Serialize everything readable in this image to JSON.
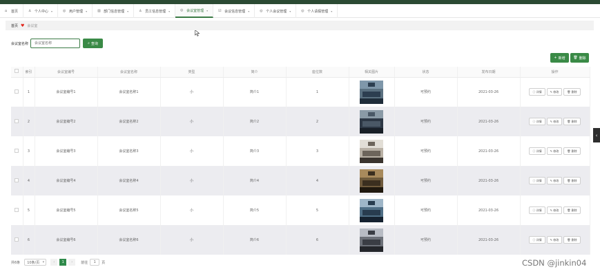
{
  "nav": {
    "items": [
      {
        "label": "首页",
        "icon": "home-icon"
      },
      {
        "label": "个人中心",
        "icon": "user-icon"
      },
      {
        "label": "用户管理",
        "icon": "circle-icon"
      },
      {
        "label": "部门信息管理",
        "icon": "bar-icon"
      },
      {
        "label": "员工信息管理",
        "icon": "person-icon"
      },
      {
        "label": "会议室管理",
        "icon": "circle-icon"
      },
      {
        "label": "会议信息管理",
        "icon": "check-icon"
      },
      {
        "label": "个人会议管理",
        "icon": "circle-icon"
      },
      {
        "label": "个人请假管理",
        "icon": "circle-icon"
      }
    ]
  },
  "breadcrumb": {
    "home": "首页",
    "current": "会议室"
  },
  "search": {
    "label": "会议室名称",
    "placeholder": "会议室名称",
    "button": "查询"
  },
  "toolbar": {
    "add": "新增",
    "delete": "删除"
  },
  "table": {
    "headers": [
      "",
      "索引",
      "会议室编号",
      "会议室名称",
      "类型",
      "简介",
      "座位数",
      "相关图片",
      "状态",
      "发布日期",
      "操作"
    ],
    "rows": [
      {
        "index": "1",
        "code": "会议室编号1",
        "name": "会议室名称1",
        "type": "小",
        "intro": "简介1",
        "seats": "1",
        "status": "可预约",
        "date": "2021-03-26"
      },
      {
        "index": "2",
        "code": "会议室编号2",
        "name": "会议室名称2",
        "type": "小",
        "intro": "简介2",
        "seats": "2",
        "status": "可预约",
        "date": "2021-03-26"
      },
      {
        "index": "3",
        "code": "会议室编号3",
        "name": "会议室名称3",
        "type": "小",
        "intro": "简介3",
        "seats": "3",
        "status": "可预约",
        "date": "2021-03-26"
      },
      {
        "index": "4",
        "code": "会议室编号4",
        "name": "会议室名称4",
        "type": "小",
        "intro": "简介4",
        "seats": "4",
        "status": "可预约",
        "date": "2021-03-26"
      },
      {
        "index": "5",
        "code": "会议室编号5",
        "name": "会议室名称5",
        "type": "小",
        "intro": "简介5",
        "seats": "5",
        "status": "可预约",
        "date": "2021-03-26"
      },
      {
        "index": "6",
        "code": "会议室编号6",
        "name": "会议室名称6",
        "type": "小",
        "intro": "简介6",
        "seats": "6",
        "status": "可预约",
        "date": "2021-03-26"
      }
    ],
    "ops": {
      "detail": "详情",
      "edit": "修改",
      "delete": "删除"
    }
  },
  "pager": {
    "total": "共6条",
    "size": "10条/页",
    "page": "1",
    "goto": "前往",
    "goto_value": "1",
    "unit": "页"
  },
  "watermark": "CSDN @jinkin04",
  "colors": {
    "accent": "#3a8a46",
    "topbar": "#2b4a33"
  }
}
